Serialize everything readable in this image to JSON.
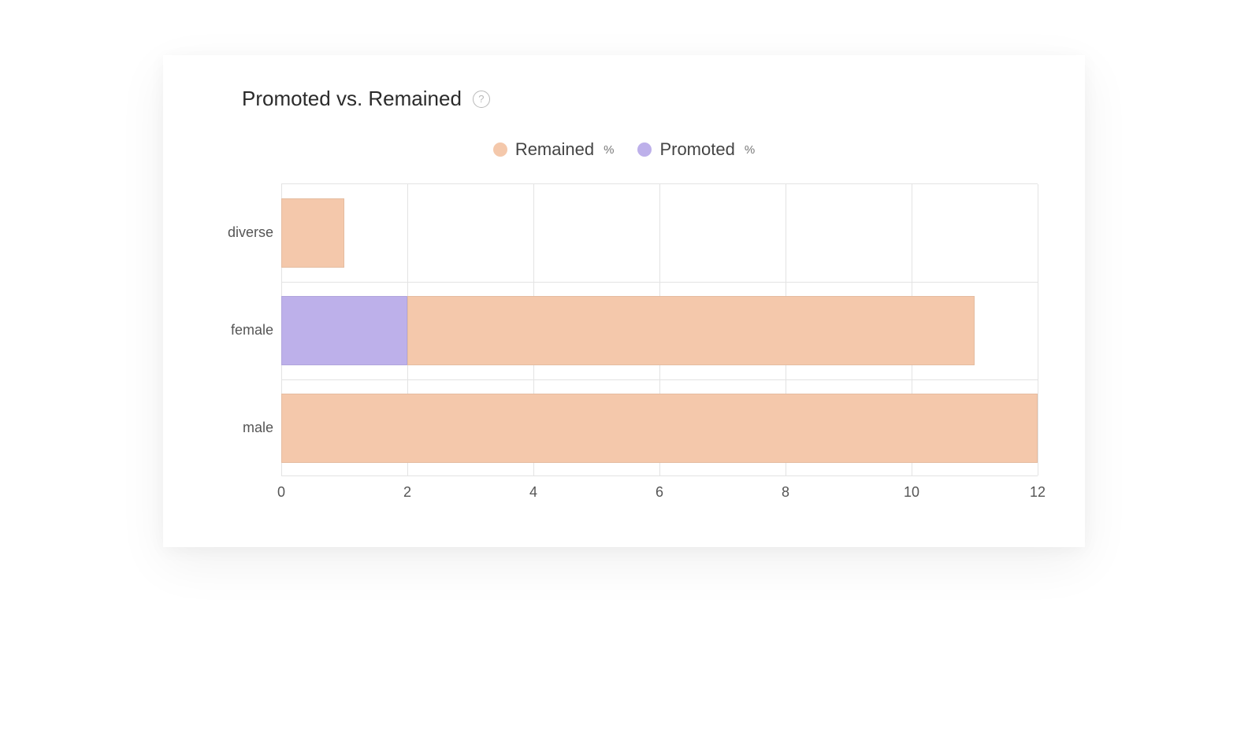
{
  "title": "Promoted vs. Remained",
  "legend": [
    {
      "label": "Remained",
      "unit": "%",
      "color": "#f4c8ab"
    },
    {
      "label": "Promoted",
      "unit": "%",
      "color": "#bdb0ea"
    }
  ],
  "chart_data": {
    "type": "bar",
    "orientation": "horizontal",
    "stacked": true,
    "categories": [
      "diverse",
      "female",
      "male"
    ],
    "series": [
      {
        "name": "Promoted",
        "color": "#bdb0ea",
        "values": [
          0,
          2,
          0
        ]
      },
      {
        "name": "Remained",
        "color": "#f4c8ab",
        "values": [
          1,
          9,
          12
        ]
      }
    ],
    "xlabel": "",
    "ylabel": "",
    "xlim": [
      0,
      12
    ],
    "xticks": [
      0,
      2,
      4,
      6,
      8,
      10,
      12
    ],
    "grid": true
  }
}
